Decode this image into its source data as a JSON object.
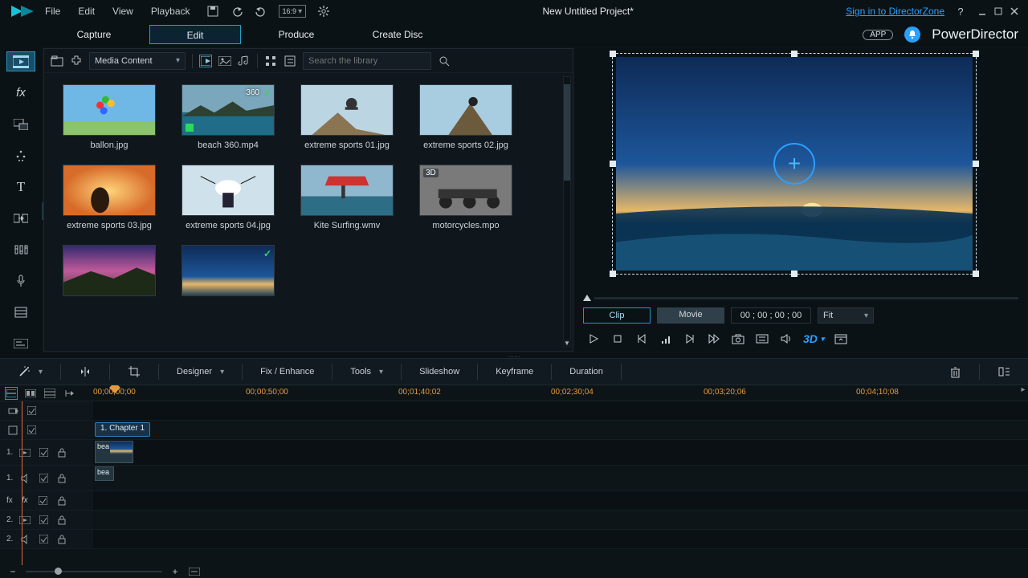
{
  "menu": {
    "file": "File",
    "edit": "Edit",
    "view": "View",
    "playback": "Playback"
  },
  "project_title": "New Untitled Project*",
  "signin": "Sign in to DirectorZone",
  "aspect_label": "16:9",
  "mode_tabs": {
    "capture": "Capture",
    "edit": "Edit",
    "produce": "Produce",
    "disc": "Create Disc"
  },
  "app_badge": "APP",
  "brand": "PowerDirector",
  "library": {
    "select_label": "Media Content",
    "search_placeholder": "Search the library",
    "items": [
      {
        "name": "ballon.jpg",
        "tag": ""
      },
      {
        "name": "beach 360.mp4",
        "tag": "360",
        "check": true
      },
      {
        "name": "extreme sports 01.jpg",
        "tag": ""
      },
      {
        "name": "extreme sports 02.jpg",
        "tag": ""
      },
      {
        "name": "extreme sports 03.jpg",
        "tag": ""
      },
      {
        "name": "extreme sports 04.jpg",
        "tag": ""
      },
      {
        "name": "Kite Surfing.wmv",
        "tag": ""
      },
      {
        "name": "motorcycles.mpo",
        "tag": "3D"
      },
      {
        "name": "",
        "tag": ""
      },
      {
        "name": "",
        "tag": "",
        "check": true
      }
    ]
  },
  "preview": {
    "clip": "Clip",
    "movie": "Movie",
    "timecode": "00 ; 00 ; 00 ; 00",
    "fit": "Fit",
    "three_d": "3D"
  },
  "actionbar": {
    "designer": "Designer",
    "fix": "Fix / Enhance",
    "tools": "Tools",
    "slideshow": "Slideshow",
    "keyframe": "Keyframe",
    "duration": "Duration"
  },
  "timeline": {
    "ticks": [
      "00;00;00;00",
      "00;00;50;00",
      "00;01;40;02",
      "00;02;30;04",
      "00;03;20;06",
      "00;04;10;08"
    ],
    "chapter": "1. Chapter 1",
    "tracks": [
      {
        "idx": "",
        "kind": "marker"
      },
      {
        "idx": "",
        "kind": "chapter"
      },
      {
        "idx": "1.",
        "kind": "video",
        "clip": "bea"
      },
      {
        "idx": "1.",
        "kind": "audio",
        "clip": "bea"
      },
      {
        "idx": "fx",
        "kind": "fx"
      },
      {
        "idx": "2.",
        "kind": "video2"
      },
      {
        "idx": "2.",
        "kind": "audio2"
      }
    ]
  }
}
